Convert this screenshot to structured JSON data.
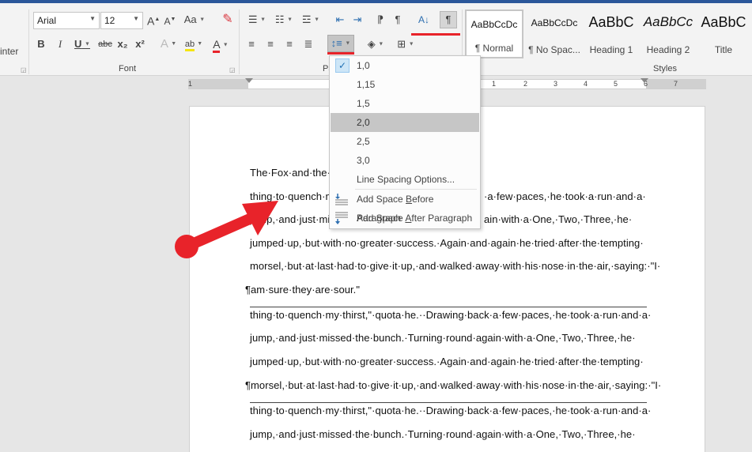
{
  "ribbon": {
    "painter_label": "inter",
    "font": {
      "family_value": "Arial",
      "size_value": "12",
      "group_label": "Font",
      "bold_label": "B",
      "italic_label": "I",
      "underline_label": "U",
      "strike_label": "abc",
      "subscript_label": "x₂",
      "superscript_label": "x²",
      "grow_label": "A",
      "shrink_label": "A",
      "case_label": "Aa",
      "highlight_label": "ab",
      "color_label": "A"
    },
    "paragraph": {
      "group_label": "Pa",
      "pilcrow_label": "¶",
      "sort_label": "A↓",
      "line_spacing_icon": "line-spacing-icon"
    },
    "styles": {
      "group_label": "Styles",
      "items": [
        {
          "sample": "AaBbCcDc",
          "name": "¶ Normal"
        },
        {
          "sample": "AaBbCcDc",
          "name": "¶ No Spac..."
        },
        {
          "sample": "AaBbC",
          "name": "Heading 1"
        },
        {
          "sample": "AaBbCс",
          "name": "Heading 2"
        },
        {
          "sample": "AaBbC",
          "name": "Title"
        }
      ]
    }
  },
  "ruler": {
    "numbers": [
      "1",
      "1",
      "2",
      "3",
      "4",
      "5",
      "6",
      "7"
    ]
  },
  "document": {
    "lines": [
      "The·Fox·and·the·G",
      "thing·to·quench·m",
      "jump,·and·just·mis",
      "jumped·up,·but·with·no·greater·success.·Again·and·again·he·tried·after·the·tempting·",
      "morsel,·but·at·last·had·to·give·it·up,·and·walked·away·with·his·nose·in·the·air,·saying:·\"I·",
      "¶am·sure·they·are·sour.\"",
      "thing·to·quench·my·thirst,\"·quota·he.··Drawing·back·a·few·paces,·he·took·a·run·and·a·",
      "jump,·and·just·missed·the·bunch.·Turning·round·again·with·a·One,·Two,·Three,·he·",
      "jumped·up,·but·with·no·greater·success.·Again·and·again·he·tried·after·the·tempting·",
      "¶morsel,·but·at·last·had·to·give·it·up,·and·walked·away·with·his·nose·in·the·air,·saying:·\"I·",
      "thing·to·quench·my·thirst,\"·quota·he.··Drawing·back·a·few·paces,·he·took·a·run·and·a·",
      "jump,·and·just·missed·the·bunch.·Turning·round·again·with·a·One,·Two,·Three,·he·"
    ],
    "line2_tail": "·a·few·paces,·he·took·a·run·and·a·",
    "line3_tail": "ain·with·a·One,·Two,·Three,·he·"
  },
  "line_spacing_menu": {
    "options": [
      "1,0",
      "1,15",
      "1,5",
      "2,0",
      "2,5",
      "3,0"
    ],
    "selected": "1,0",
    "hovered": "2,0",
    "more_options": "Line Spacing Options...",
    "add_before_pre": "Add Space ",
    "add_before_u": "B",
    "add_before_post": "efore Paragraph",
    "add_after_pre": "Add Space ",
    "add_after_u": "A",
    "add_after_post": "fter Paragraph"
  },
  "colors": {
    "accent_blue": "#2b579a",
    "annotation_red": "#e8232a",
    "hover_grey": "#c6c6c6"
  }
}
